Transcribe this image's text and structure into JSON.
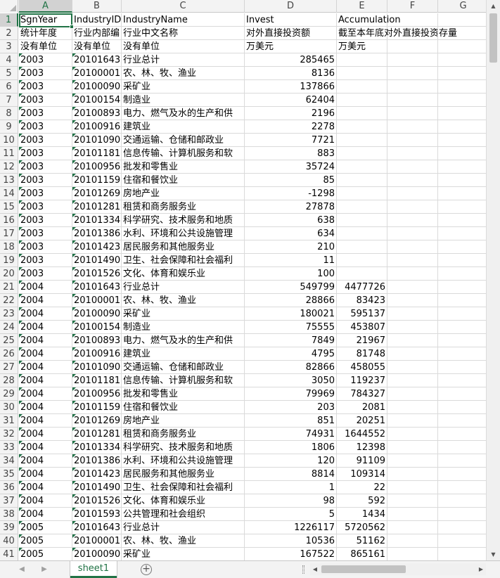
{
  "columns": [
    "A",
    "B",
    "C",
    "D",
    "E",
    "F",
    "G"
  ],
  "active_column": "A",
  "active_row": "1",
  "rows": [
    {
      "n": "1",
      "a": "SgnYear",
      "b": "IndustryID",
      "c": "IndustryName",
      "d": "Invest",
      "e": "Accumulation",
      "d_num": false,
      "e_num": false,
      "tri": false
    },
    {
      "n": "2",
      "a": "统计年度",
      "b": "行业内部编",
      "c": "行业中文名称",
      "d": "对外直接投资额",
      "e": "截至本年底对外直接投资存量",
      "d_num": false,
      "e_num": false,
      "tri": false
    },
    {
      "n": "3",
      "a": "没有单位",
      "b": "没有单位",
      "c": "没有单位",
      "d": "万美元",
      "e": "万美元",
      "d_num": false,
      "e_num": false,
      "tri": false
    },
    {
      "n": "4",
      "a": "2003",
      "b": "20101643",
      "c": "行业总计",
      "d": "285465",
      "e": "",
      "d_num": true,
      "e_num": true,
      "tri": true
    },
    {
      "n": "5",
      "a": "2003",
      "b": "20100001",
      "c": "农、林、牧、渔业",
      "d": "8136",
      "e": "",
      "d_num": true,
      "e_num": true,
      "tri": true
    },
    {
      "n": "6",
      "a": "2003",
      "b": "20100090",
      "c": "采矿业",
      "d": "137866",
      "e": "",
      "d_num": true,
      "e_num": true,
      "tri": true
    },
    {
      "n": "7",
      "a": "2003",
      "b": "20100154",
      "c": "制造业",
      "d": "62404",
      "e": "",
      "d_num": true,
      "e_num": true,
      "tri": true
    },
    {
      "n": "8",
      "a": "2003",
      "b": "20100893",
      "c": "电力、燃气及水的生产和供",
      "d": "2196",
      "e": "",
      "d_num": true,
      "e_num": true,
      "tri": true
    },
    {
      "n": "9",
      "a": "2003",
      "b": "20100916",
      "c": "建筑业",
      "d": "2278",
      "e": "",
      "d_num": true,
      "e_num": true,
      "tri": true
    },
    {
      "n": "10",
      "a": "2003",
      "b": "20101090",
      "c": "交通运输、仓储和邮政业",
      "d": "7721",
      "e": "",
      "d_num": true,
      "e_num": true,
      "tri": true
    },
    {
      "n": "11",
      "a": "2003",
      "b": "20101181",
      "c": "信息传输、计算机服务和软",
      "d": "883",
      "e": "",
      "d_num": true,
      "e_num": true,
      "tri": true
    },
    {
      "n": "12",
      "a": "2003",
      "b": "20100956",
      "c": "批发和零售业",
      "d": "35724",
      "e": "",
      "d_num": true,
      "e_num": true,
      "tri": true
    },
    {
      "n": "13",
      "a": "2003",
      "b": "20101159",
      "c": "住宿和餐饮业",
      "d": "85",
      "e": "",
      "d_num": true,
      "e_num": true,
      "tri": true
    },
    {
      "n": "14",
      "a": "2003",
      "b": "20101269",
      "c": "房地产业",
      "d": "-1298",
      "e": "",
      "d_num": true,
      "e_num": true,
      "tri": true
    },
    {
      "n": "15",
      "a": "2003",
      "b": "20101281",
      "c": "租赁和商务服务业",
      "d": "27878",
      "e": "",
      "d_num": true,
      "e_num": true,
      "tri": true
    },
    {
      "n": "16",
      "a": "2003",
      "b": "20101334",
      "c": "科学研究、技术服务和地质",
      "d": "638",
      "e": "",
      "d_num": true,
      "e_num": true,
      "tri": true
    },
    {
      "n": "17",
      "a": "2003",
      "b": "20101386",
      "c": "水利、环境和公共设施管理",
      "d": "634",
      "e": "",
      "d_num": true,
      "e_num": true,
      "tri": true
    },
    {
      "n": "18",
      "a": "2003",
      "b": "20101423",
      "c": "居民服务和其他服务业",
      "d": "210",
      "e": "",
      "d_num": true,
      "e_num": true,
      "tri": true
    },
    {
      "n": "19",
      "a": "2003",
      "b": "20101490",
      "c": "卫生、社会保障和社会福利",
      "d": "11",
      "e": "",
      "d_num": true,
      "e_num": true,
      "tri": true
    },
    {
      "n": "20",
      "a": "2003",
      "b": "20101526",
      "c": "文化、体育和娱乐业",
      "d": "100",
      "e": "",
      "d_num": true,
      "e_num": true,
      "tri": true
    },
    {
      "n": "21",
      "a": "2004",
      "b": "20101643",
      "c": "行业总计",
      "d": "549799",
      "e": "4477726",
      "d_num": true,
      "e_num": true,
      "tri": true
    },
    {
      "n": "22",
      "a": "2004",
      "b": "20100001",
      "c": "农、林、牧、渔业",
      "d": "28866",
      "e": "83423",
      "d_num": true,
      "e_num": true,
      "tri": true
    },
    {
      "n": "23",
      "a": "2004",
      "b": "20100090",
      "c": "采矿业",
      "d": "180021",
      "e": "595137",
      "d_num": true,
      "e_num": true,
      "tri": true
    },
    {
      "n": "24",
      "a": "2004",
      "b": "20100154",
      "c": "制造业",
      "d": "75555",
      "e": "453807",
      "d_num": true,
      "e_num": true,
      "tri": true
    },
    {
      "n": "25",
      "a": "2004",
      "b": "20100893",
      "c": "电力、燃气及水的生产和供",
      "d": "7849",
      "e": "21967",
      "d_num": true,
      "e_num": true,
      "tri": true
    },
    {
      "n": "26",
      "a": "2004",
      "b": "20100916",
      "c": "建筑业",
      "d": "4795",
      "e": "81748",
      "d_num": true,
      "e_num": true,
      "tri": true
    },
    {
      "n": "27",
      "a": "2004",
      "b": "20101090",
      "c": "交通运输、仓储和邮政业",
      "d": "82866",
      "e": "458055",
      "d_num": true,
      "e_num": true,
      "tri": true
    },
    {
      "n": "28",
      "a": "2004",
      "b": "20101181",
      "c": "信息传输、计算机服务和软",
      "d": "3050",
      "e": "119237",
      "d_num": true,
      "e_num": true,
      "tri": true
    },
    {
      "n": "29",
      "a": "2004",
      "b": "20100956",
      "c": "批发和零售业",
      "d": "79969",
      "e": "784327",
      "d_num": true,
      "e_num": true,
      "tri": true
    },
    {
      "n": "30",
      "a": "2004",
      "b": "20101159",
      "c": "住宿和餐饮业",
      "d": "203",
      "e": "2081",
      "d_num": true,
      "e_num": true,
      "tri": true
    },
    {
      "n": "31",
      "a": "2004",
      "b": "20101269",
      "c": "房地产业",
      "d": "851",
      "e": "20251",
      "d_num": true,
      "e_num": true,
      "tri": true
    },
    {
      "n": "32",
      "a": "2004",
      "b": "20101281",
      "c": "租赁和商务服务业",
      "d": "74931",
      "e": "1644552",
      "d_num": true,
      "e_num": true,
      "tri": true
    },
    {
      "n": "33",
      "a": "2004",
      "b": "20101334",
      "c": "科学研究、技术服务和地质",
      "d": "1806",
      "e": "12398",
      "d_num": true,
      "e_num": true,
      "tri": true
    },
    {
      "n": "34",
      "a": "2004",
      "b": "20101386",
      "c": "水利、环境和公共设施管理",
      "d": "120",
      "e": "91109",
      "d_num": true,
      "e_num": true,
      "tri": true
    },
    {
      "n": "35",
      "a": "2004",
      "b": "20101423",
      "c": "居民服务和其他服务业",
      "d": "8814",
      "e": "109314",
      "d_num": true,
      "e_num": true,
      "tri": true
    },
    {
      "n": "36",
      "a": "2004",
      "b": "20101490",
      "c": "卫生、社会保障和社会福利",
      "d": "1",
      "e": "22",
      "d_num": true,
      "e_num": true,
      "tri": true
    },
    {
      "n": "37",
      "a": "2004",
      "b": "20101526",
      "c": "文化、体育和娱乐业",
      "d": "98",
      "e": "592",
      "d_num": true,
      "e_num": true,
      "tri": true
    },
    {
      "n": "38",
      "a": "2004",
      "b": "20101593",
      "c": "公共管理和社会组织",
      "d": "5",
      "e": "1434",
      "d_num": true,
      "e_num": true,
      "tri": true
    },
    {
      "n": "39",
      "a": "2005",
      "b": "20101643",
      "c": "行业总计",
      "d": "1226117",
      "e": "5720562",
      "d_num": true,
      "e_num": true,
      "tri": true
    },
    {
      "n": "40",
      "a": "2005",
      "b": "20100001",
      "c": "农、林、牧、渔业",
      "d": "10536",
      "e": "51162",
      "d_num": true,
      "e_num": true,
      "tri": true
    },
    {
      "n": "41",
      "a": "2005",
      "b": "20100090",
      "c": "采矿业",
      "d": "167522",
      "e": "865161",
      "d_num": true,
      "e_num": true,
      "tri": true
    }
  ],
  "sheet_tab": {
    "label": "sheet1"
  },
  "icons": {
    "nav_prev": "caret-left-icon",
    "nav_next": "caret-right-icon",
    "add_sheet": "plus-circle-icon",
    "scroll_up": "triangle-up-icon",
    "scroll_down": "triangle-down-icon",
    "scroll_left": "triangle-left-icon",
    "scroll_right": "triangle-right-icon"
  },
  "colors": {
    "accent": "#217346",
    "gridline": "#dadada",
    "header_bg": "#f3f3f3"
  }
}
